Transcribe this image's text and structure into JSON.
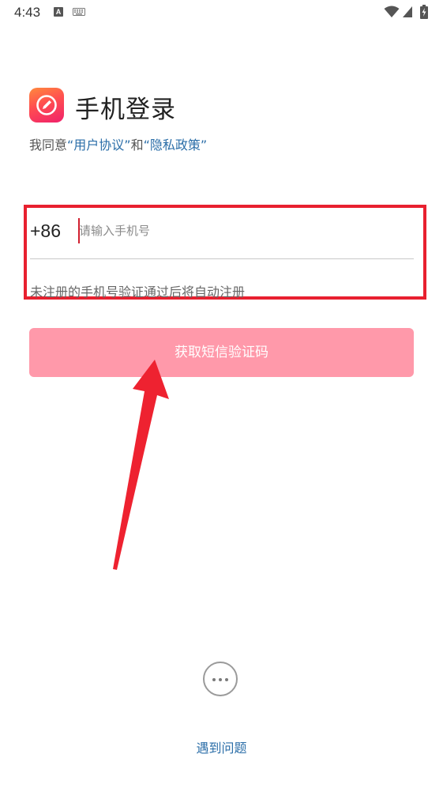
{
  "status_bar": {
    "time": "4:43",
    "a_badge": "A",
    "icons": [
      "a-notification-icon",
      "keyboard-icon",
      "wifi-icon",
      "signal-icon",
      "battery-charging-icon"
    ]
  },
  "header": {
    "logo_icon": "pencil-circle-icon",
    "title": "手机登录",
    "agreement": {
      "prefix": "我同意",
      "link1": "“用户协议”",
      "middle": "和",
      "link2": "“隐私政策”"
    }
  },
  "form": {
    "country_code": "+86",
    "phone_placeholder": "请输入手机号",
    "phone_value": "",
    "hint": "未注册的手机号验证通过后将自动注册",
    "highlight_color": "#e8202f"
  },
  "get_code_button": {
    "label": "获取短信验证码",
    "color": "#ff99aa"
  },
  "footer": {
    "more_icon": "more-horizontal-icon",
    "help_link": "遇到问题"
  },
  "colors": {
    "link": "#2b6ea8",
    "annotation": "#e8202f",
    "logo_gradient_start": "#ff8a3d",
    "logo_gradient_end": "#f0216b"
  }
}
